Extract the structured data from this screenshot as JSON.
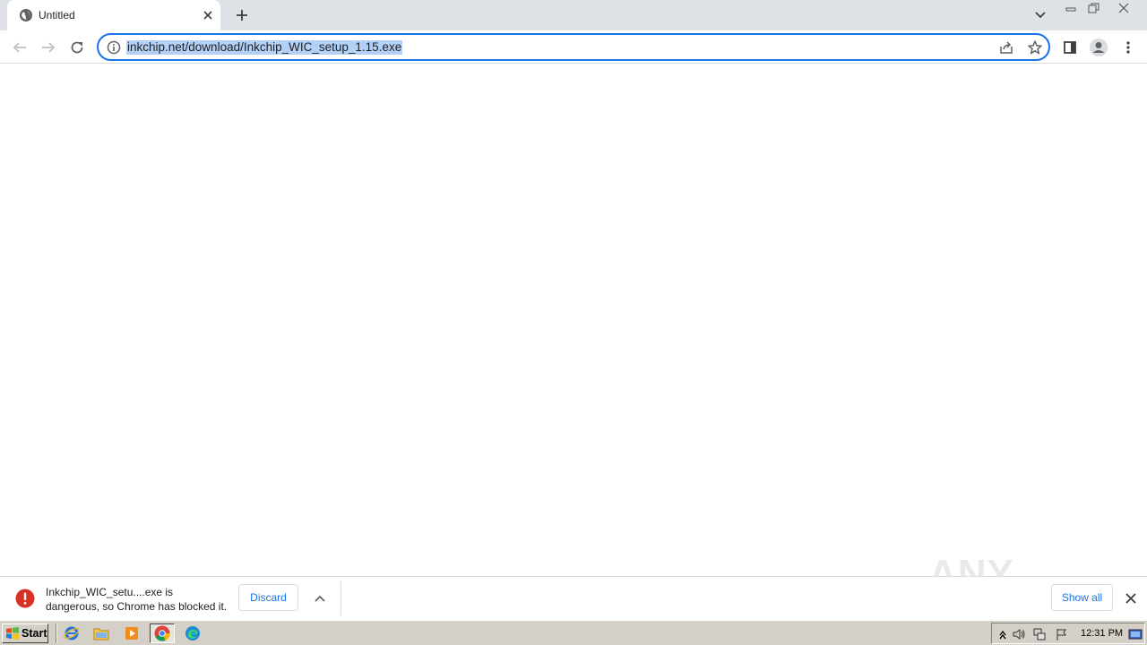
{
  "browser": {
    "tab": {
      "title": "Untitled"
    },
    "address_bar": {
      "url": "inkchip.net/download/Inkchip_WIC_setup_1.15.exe"
    }
  },
  "download_shelf": {
    "message_line1": "Inkchip_WIC_setu....exe is",
    "message_line2": "dangerous, so Chrome has blocked it.",
    "discard_label": "Discard",
    "show_all_label": "Show all"
  },
  "watermark": {
    "text": "ANY RUN"
  },
  "taskbar": {
    "start_label": "Start",
    "clock": "12:31 PM"
  },
  "colors": {
    "accent": "#1a73e8",
    "danger": "#d93025",
    "selection": "#b3d0f7"
  }
}
